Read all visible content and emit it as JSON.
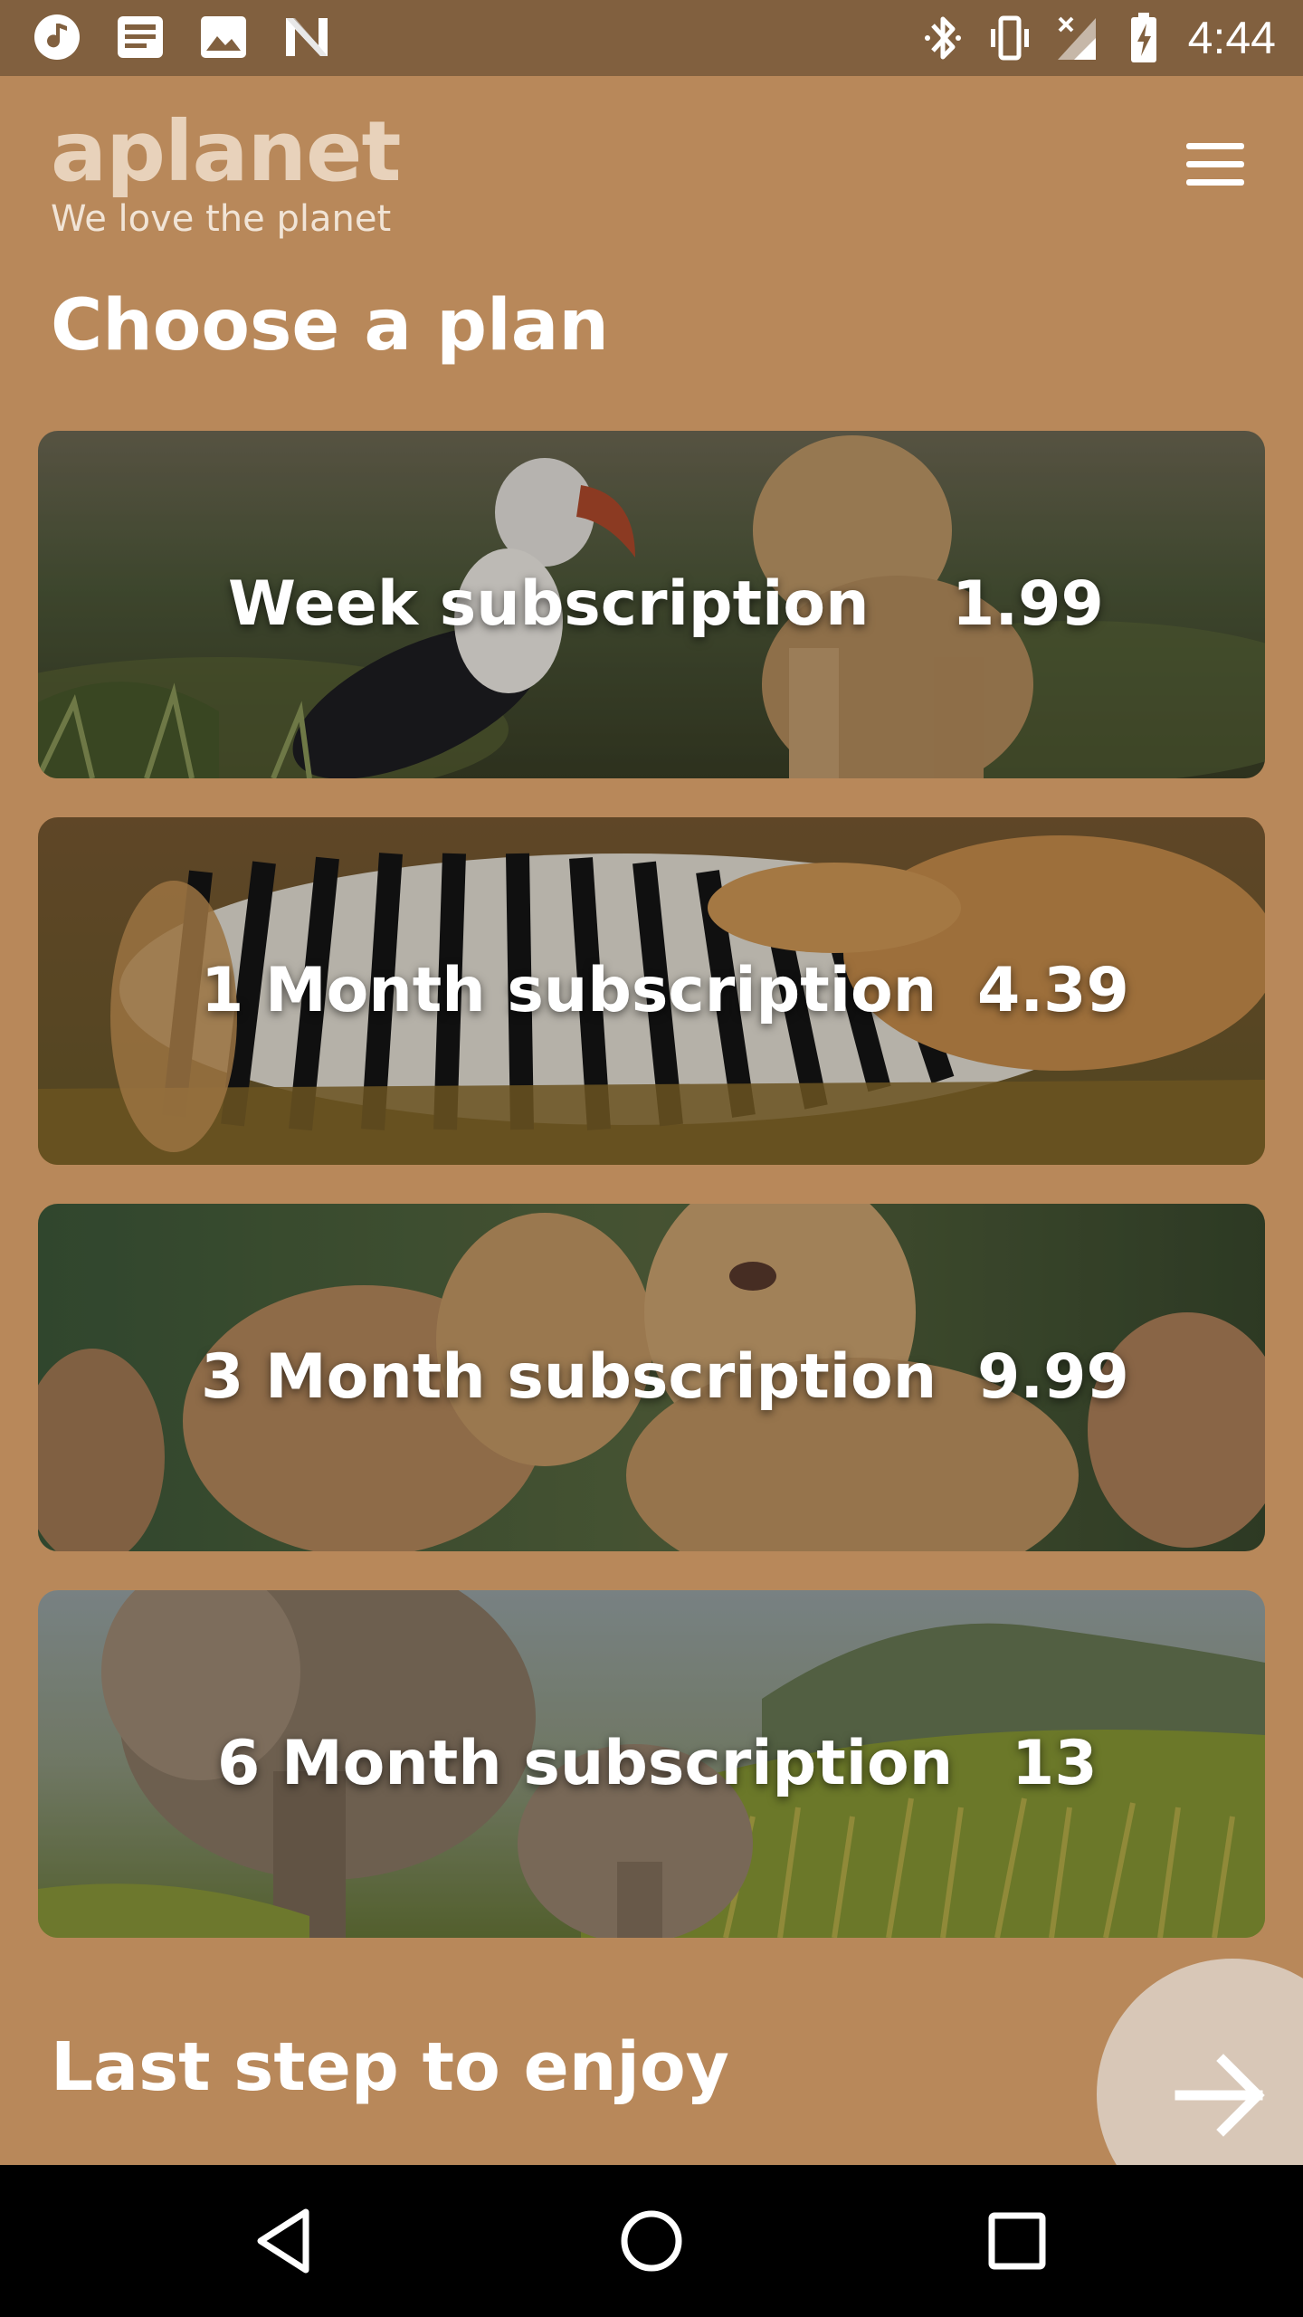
{
  "status_bar": {
    "time": "4:44",
    "left_icons": [
      "music-note-icon",
      "news-icon",
      "image-icon",
      "n-notification-icon"
    ],
    "right_icons": [
      "bluetooth-icon",
      "vibrate-icon",
      "signal-icon",
      "battery-charging-icon"
    ]
  },
  "header": {
    "logo": "aplanet",
    "tagline": "We love the planet",
    "menu_icon": "hamburger-menu-icon"
  },
  "page_title": "Choose a plan",
  "plans": [
    {
      "name": "Week subscription",
      "price": "1.99",
      "image": "hornbill-and-lion-cub-photo"
    },
    {
      "name": "1 Month subscription",
      "price": "4.39",
      "image": "lion-hunting-zebra-photo"
    },
    {
      "name": "3 Month subscription",
      "price": "9.99",
      "image": "lioness-and-cub-photo"
    },
    {
      "name": "6 Month subscription",
      "price": "13",
      "image": "elephants-in-grass-photo"
    }
  ],
  "footer": {
    "text": "Last step to enjoy",
    "next_icon": "arrow-right-icon"
  },
  "nav_bar": {
    "icons": [
      "back-triangle-icon",
      "home-circle-icon",
      "recents-square-icon"
    ]
  },
  "colors": {
    "background": "#b8885a",
    "status_bar": "#81603f",
    "logo": "#e8d2bb",
    "next_button": "#d8c7b7",
    "nav_bar": "#000000"
  }
}
